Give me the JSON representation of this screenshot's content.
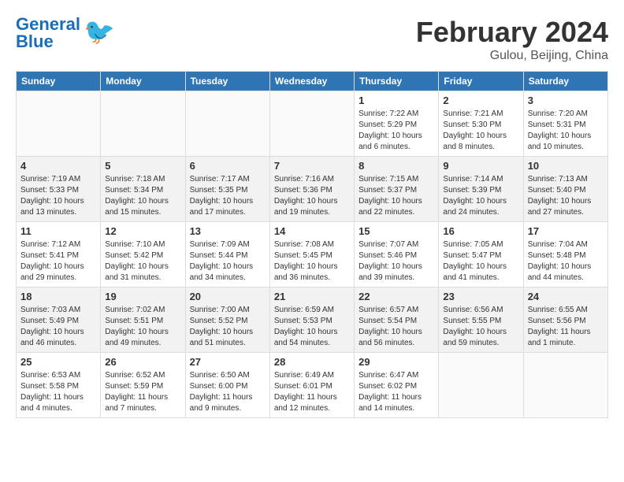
{
  "header": {
    "logo_general": "General",
    "logo_blue": "Blue",
    "month_title": "February 2024",
    "location": "Gulou, Beijing, China"
  },
  "days_of_week": [
    "Sunday",
    "Monday",
    "Tuesday",
    "Wednesday",
    "Thursday",
    "Friday",
    "Saturday"
  ],
  "weeks": [
    [
      {
        "day": "",
        "info": ""
      },
      {
        "day": "",
        "info": ""
      },
      {
        "day": "",
        "info": ""
      },
      {
        "day": "",
        "info": ""
      },
      {
        "day": "1",
        "info": "Sunrise: 7:22 AM\nSunset: 5:29 PM\nDaylight: 10 hours\nand 6 minutes."
      },
      {
        "day": "2",
        "info": "Sunrise: 7:21 AM\nSunset: 5:30 PM\nDaylight: 10 hours\nand 8 minutes."
      },
      {
        "day": "3",
        "info": "Sunrise: 7:20 AM\nSunset: 5:31 PM\nDaylight: 10 hours\nand 10 minutes."
      }
    ],
    [
      {
        "day": "4",
        "info": "Sunrise: 7:19 AM\nSunset: 5:33 PM\nDaylight: 10 hours\nand 13 minutes."
      },
      {
        "day": "5",
        "info": "Sunrise: 7:18 AM\nSunset: 5:34 PM\nDaylight: 10 hours\nand 15 minutes."
      },
      {
        "day": "6",
        "info": "Sunrise: 7:17 AM\nSunset: 5:35 PM\nDaylight: 10 hours\nand 17 minutes."
      },
      {
        "day": "7",
        "info": "Sunrise: 7:16 AM\nSunset: 5:36 PM\nDaylight: 10 hours\nand 19 minutes."
      },
      {
        "day": "8",
        "info": "Sunrise: 7:15 AM\nSunset: 5:37 PM\nDaylight: 10 hours\nand 22 minutes."
      },
      {
        "day": "9",
        "info": "Sunrise: 7:14 AM\nSunset: 5:39 PM\nDaylight: 10 hours\nand 24 minutes."
      },
      {
        "day": "10",
        "info": "Sunrise: 7:13 AM\nSunset: 5:40 PM\nDaylight: 10 hours\nand 27 minutes."
      }
    ],
    [
      {
        "day": "11",
        "info": "Sunrise: 7:12 AM\nSunset: 5:41 PM\nDaylight: 10 hours\nand 29 minutes."
      },
      {
        "day": "12",
        "info": "Sunrise: 7:10 AM\nSunset: 5:42 PM\nDaylight: 10 hours\nand 31 minutes."
      },
      {
        "day": "13",
        "info": "Sunrise: 7:09 AM\nSunset: 5:44 PM\nDaylight: 10 hours\nand 34 minutes."
      },
      {
        "day": "14",
        "info": "Sunrise: 7:08 AM\nSunset: 5:45 PM\nDaylight: 10 hours\nand 36 minutes."
      },
      {
        "day": "15",
        "info": "Sunrise: 7:07 AM\nSunset: 5:46 PM\nDaylight: 10 hours\nand 39 minutes."
      },
      {
        "day": "16",
        "info": "Sunrise: 7:05 AM\nSunset: 5:47 PM\nDaylight: 10 hours\nand 41 minutes."
      },
      {
        "day": "17",
        "info": "Sunrise: 7:04 AM\nSunset: 5:48 PM\nDaylight: 10 hours\nand 44 minutes."
      }
    ],
    [
      {
        "day": "18",
        "info": "Sunrise: 7:03 AM\nSunset: 5:49 PM\nDaylight: 10 hours\nand 46 minutes."
      },
      {
        "day": "19",
        "info": "Sunrise: 7:02 AM\nSunset: 5:51 PM\nDaylight: 10 hours\nand 49 minutes."
      },
      {
        "day": "20",
        "info": "Sunrise: 7:00 AM\nSunset: 5:52 PM\nDaylight: 10 hours\nand 51 minutes."
      },
      {
        "day": "21",
        "info": "Sunrise: 6:59 AM\nSunset: 5:53 PM\nDaylight: 10 hours\nand 54 minutes."
      },
      {
        "day": "22",
        "info": "Sunrise: 6:57 AM\nSunset: 5:54 PM\nDaylight: 10 hours\nand 56 minutes."
      },
      {
        "day": "23",
        "info": "Sunrise: 6:56 AM\nSunset: 5:55 PM\nDaylight: 10 hours\nand 59 minutes."
      },
      {
        "day": "24",
        "info": "Sunrise: 6:55 AM\nSunset: 5:56 PM\nDaylight: 11 hours\nand 1 minute."
      }
    ],
    [
      {
        "day": "25",
        "info": "Sunrise: 6:53 AM\nSunset: 5:58 PM\nDaylight: 11 hours\nand 4 minutes."
      },
      {
        "day": "26",
        "info": "Sunrise: 6:52 AM\nSunset: 5:59 PM\nDaylight: 11 hours\nand 7 minutes."
      },
      {
        "day": "27",
        "info": "Sunrise: 6:50 AM\nSunset: 6:00 PM\nDaylight: 11 hours\nand 9 minutes."
      },
      {
        "day": "28",
        "info": "Sunrise: 6:49 AM\nSunset: 6:01 PM\nDaylight: 11 hours\nand 12 minutes."
      },
      {
        "day": "29",
        "info": "Sunrise: 6:47 AM\nSunset: 6:02 PM\nDaylight: 11 hours\nand 14 minutes."
      },
      {
        "day": "",
        "info": ""
      },
      {
        "day": "",
        "info": ""
      }
    ]
  ]
}
